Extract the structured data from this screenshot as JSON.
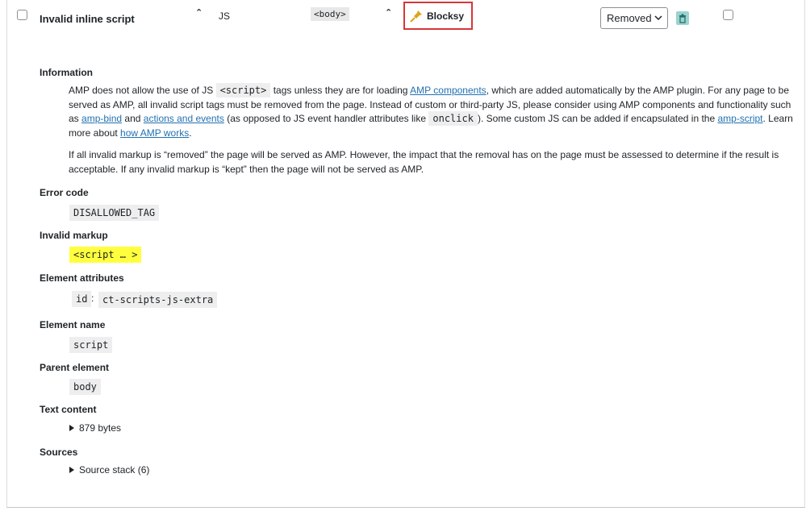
{
  "row": {
    "title": "Invalid inline script",
    "type": "JS",
    "parent_tag": "<body>",
    "source": "Blocksy",
    "status": "Removed"
  },
  "info": {
    "heading": "Information",
    "p1_a": "AMP does not allow the use of JS",
    "p1_code1": "<script>",
    "p1_b": "tags unless they are for loading",
    "p1_link1": "AMP components",
    "p1_c": ", which are added automatically by the AMP plugin. For any page to be served as AMP, all invalid script tags must be removed from the page. Instead of custom or third-party JS, please consider using AMP components and functionality such as",
    "p1_link2": "amp-bind",
    "p1_d": "and",
    "p1_link3": "actions and events",
    "p1_e": "(as opposed to JS event handler attributes like",
    "p1_code2": "onclick",
    "p1_f": "). Some custom JS can be added if encapsulated in the",
    "p1_link4": "amp-script",
    "p1_g": ". Learn more about",
    "p1_link5": "how AMP works",
    "p1_h": ".",
    "p2": "If all invalid markup is “removed” the page will be served as AMP. However, the impact that the removal has on the page must be assessed to determine if the result is acceptable. If any invalid markup is “kept” then the page will not be served as AMP."
  },
  "error_code": {
    "heading": "Error code",
    "value": "DISALLOWED_TAG"
  },
  "invalid_markup": {
    "heading": "Invalid markup",
    "value": "<script … >"
  },
  "element_attributes": {
    "heading": "Element attributes",
    "key": "id",
    "sep": ":",
    "value": "ct-scripts-js-extra"
  },
  "element_name": {
    "heading": "Element name",
    "value": "script"
  },
  "parent_element": {
    "heading": "Parent element",
    "value": "body"
  },
  "text_content": {
    "heading": "Text content",
    "toggle": "879 bytes"
  },
  "sources": {
    "heading": "Sources",
    "toggle": "Source stack (6)"
  },
  "colors": {
    "highlight_border": "#d63638",
    "link": "#2271b1",
    "markup_highlight": "#ffff3e"
  }
}
